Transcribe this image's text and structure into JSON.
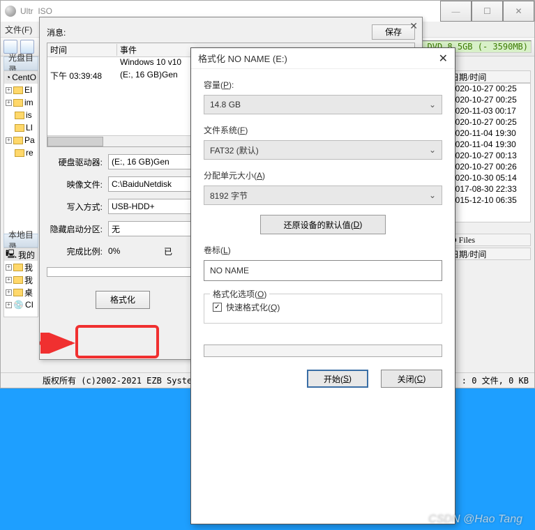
{
  "main": {
    "title_prefix": "Ultr",
    "title_mid": "ISO",
    "menu_file": "文件(F)",
    "dvd_status": " of DVD 8.5GB (- 3590MB)",
    "pane_disc": "光盘目录",
    "pane_local": "本地目录",
    "rh_date": "日期/时间",
    "rh_files": "D Files",
    "rh_date2": "日期/时间",
    "tree": [
      "CentO",
      "EI",
      "im",
      "is",
      "LI",
      "Pa",
      "re"
    ],
    "tree2": [
      "我的",
      "我",
      "我",
      "桌",
      "CI"
    ],
    "dates": [
      "2020-10-27 00:25",
      "2020-10-27 00:25",
      "2020-11-03 00:17",
      "2020-10-27 00:25",
      "2020-11-04 19:30",
      "2020-11-04 19:30",
      "2020-10-27 00:13",
      "2020-10-27 00:26",
      "2020-10-30 05:14",
      "2017-08-30 22:33",
      "2015-12-10 06:35"
    ],
    "copyright": "版权所有 (c)2002-2021 EZB Systems",
    "footer_stat": ": 0 文件, 0 KB"
  },
  "dlg": {
    "msg": "消息:",
    "save": "保存",
    "col_time": "时间",
    "col_event": "事件",
    "log_event1": "Windows 10 v10",
    "log_time2": "下午 03:39:48",
    "log_event2": "(E:, 16 GB)Gen",
    "lbl_drive": "硬盘驱动器:",
    "val_drive": "(E:, 16 GB)Gen",
    "lbl_image": "映像文件:",
    "val_image": "C:\\BaiduNetdisk",
    "lbl_write": "写入方式:",
    "val_write": "USB-HDD+",
    "lbl_hide": "隐藏启动分区:",
    "val_hide": "无",
    "lbl_pct": "完成比例:",
    "val_pct": "0%",
    "val_elapsed": "已",
    "btn_format": "格式化"
  },
  "fmt": {
    "title": "格式化 NO NAME (E:)",
    "lbl_capacity": "容量(P):",
    "val_capacity": "14.8 GB",
    "lbl_fs": "文件系统(F)",
    "val_fs": "FAT32 (默认)",
    "lbl_alloc": "分配单元大小(A)",
    "val_alloc": "8192 字节",
    "btn_restore": "还原设备的默认值(D)",
    "lbl_label": "卷标(L)",
    "val_label": "NO NAME",
    "legend": "格式化选项(O)",
    "cb_quick": "快速格式化(Q)",
    "btn_start": "开始(S)",
    "btn_close": "关闭(C)"
  },
  "watermark": "CSDN @Hao Tang"
}
